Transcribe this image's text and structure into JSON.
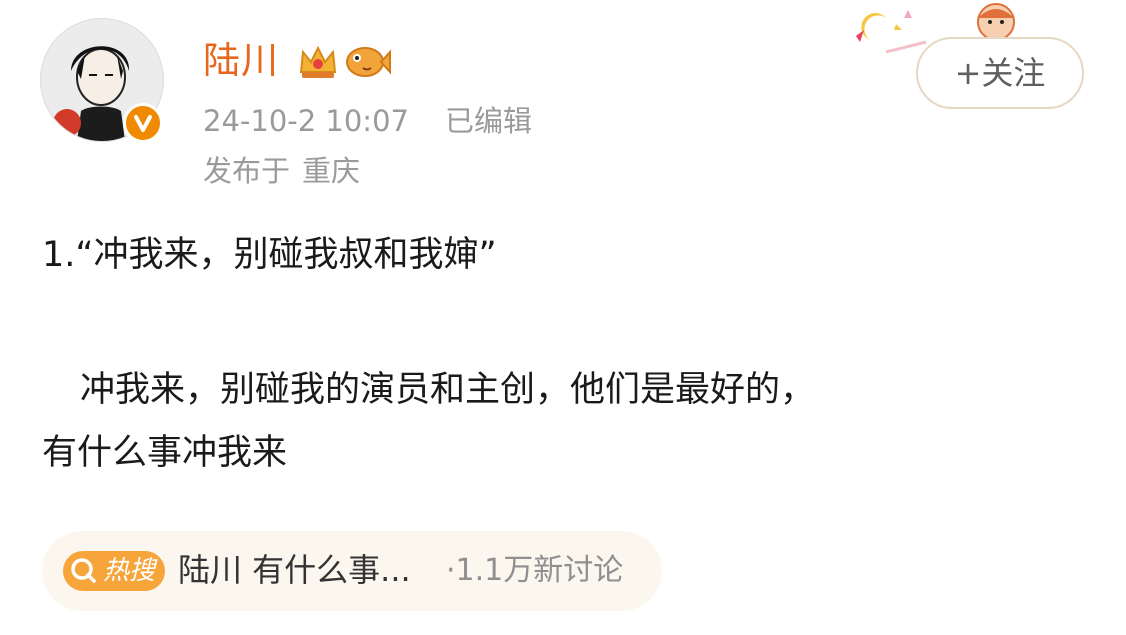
{
  "post": {
    "username": "陆川",
    "timestamp": "24-10-2 10:07",
    "edited_label": "已编辑",
    "location_prefix": "发布于",
    "location_city": "重庆",
    "follow_label": "+关注",
    "body": {
      "line1": "1.“冲我来，别碰我叔和我婶”",
      "line2": "冲我来，别碰我的演员和主创，他们是最好的，",
      "line3": "有什么事冲我来"
    },
    "hot_search": {
      "badge_label": "热搜",
      "topic": "陆川 有什么事...",
      "count": "·1.1万新讨论"
    }
  },
  "icons": {
    "avatar": "cartoon-avatar",
    "verified": "verified-badge-icon",
    "crown": "crown-icon",
    "fish": "fish-icon",
    "search": "search-icon",
    "sticker": "decorative-sticker"
  },
  "colors": {
    "username": "#e8661d",
    "meta": "#9a9a9a",
    "body_text": "#1a1a1a",
    "follow_border": "#e6d8c3",
    "hot_badge": "#f7a43a",
    "hot_pill_bg": "#fbf6ee"
  }
}
